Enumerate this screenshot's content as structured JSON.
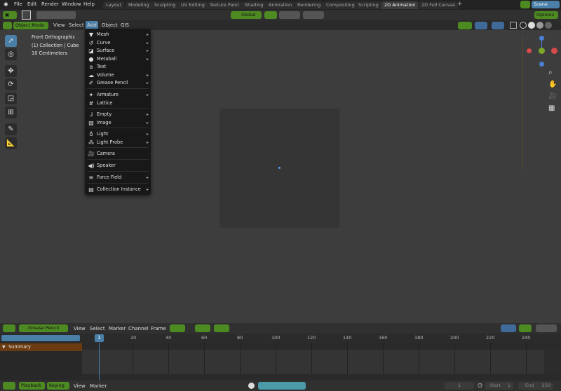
{
  "top_menu": [
    "File",
    "Edit",
    "Render",
    "Window",
    "Help"
  ],
  "workspace_tabs": [
    "Layout",
    "Modeling",
    "Sculpting",
    "UV Editing",
    "Texture Paint",
    "Shading",
    "Animation",
    "Rendering",
    "Compositing",
    "Scripting",
    "2D Animation",
    "2D Full Canvas"
  ],
  "active_tab": "2D Animation",
  "scene_name": "Scene",
  "tool_header": {
    "orientation": "Global",
    "options_label": "Options"
  },
  "view_header": {
    "mode": "Object Mode",
    "menus": [
      "View",
      "Select",
      "Add",
      "Object",
      "GIS"
    ]
  },
  "overlay_info": [
    "Front Orthographic",
    "(1) Collection | Cube",
    "10 Centimeters"
  ],
  "add_menu": [
    {
      "icon": "mesh-icon",
      "label": "Mesh",
      "sub": true
    },
    {
      "icon": "curve-icon",
      "label": "Curve",
      "sub": true
    },
    {
      "icon": "surface-icon",
      "label": "Surface",
      "sub": true
    },
    {
      "icon": "metaball-icon",
      "label": "Metaball",
      "sub": true
    },
    {
      "icon": "text-icon",
      "label": "Text",
      "sub": false
    },
    {
      "icon": "volume-icon",
      "label": "Volume",
      "sub": true
    },
    {
      "icon": "grease-pencil-icon",
      "label": "Grease Pencil",
      "sub": true
    },
    {
      "icon": "armature-icon",
      "label": "Armature",
      "sub": true
    },
    {
      "icon": "lattice-icon",
      "label": "Lattice",
      "sub": false
    },
    {
      "icon": "empty-icon",
      "label": "Empty",
      "sub": true
    },
    {
      "icon": "image-icon",
      "label": "Image",
      "sub": true
    },
    {
      "icon": "light-icon",
      "label": "Light",
      "sub": true
    },
    {
      "icon": "light-probe-icon",
      "label": "Light Probe",
      "sub": true
    },
    {
      "icon": "camera-icon",
      "label": "Camera",
      "sub": false
    },
    {
      "icon": "speaker-icon",
      "label": "Speaker",
      "sub": false
    },
    {
      "icon": "force-field-icon",
      "label": "Force Field",
      "sub": true
    },
    {
      "icon": "collection-instance-icon",
      "label": "Collection Instance",
      "sub": true
    }
  ],
  "dopesheet": {
    "mode": "Grease Pencil",
    "menus": [
      "View",
      "Select",
      "Marker",
      "Channel",
      "Frame"
    ],
    "channel": "Summary",
    "current_frame": "1",
    "ticks": [
      "20",
      "40",
      "60",
      "80",
      "100",
      "120",
      "140",
      "160",
      "180",
      "200",
      "220",
      "240"
    ]
  },
  "timeline": {
    "menus": [
      "Playback",
      "Keying",
      "View",
      "Marker"
    ],
    "frame": "1",
    "start_label": "Start",
    "start": "1",
    "end_label": "End",
    "end": "250"
  },
  "colors": {
    "accent_green": "#4e8a22",
    "selected_blue": "#4a7fa8",
    "menu_bg": "#181818",
    "summary_bg": "#6a3a10"
  }
}
